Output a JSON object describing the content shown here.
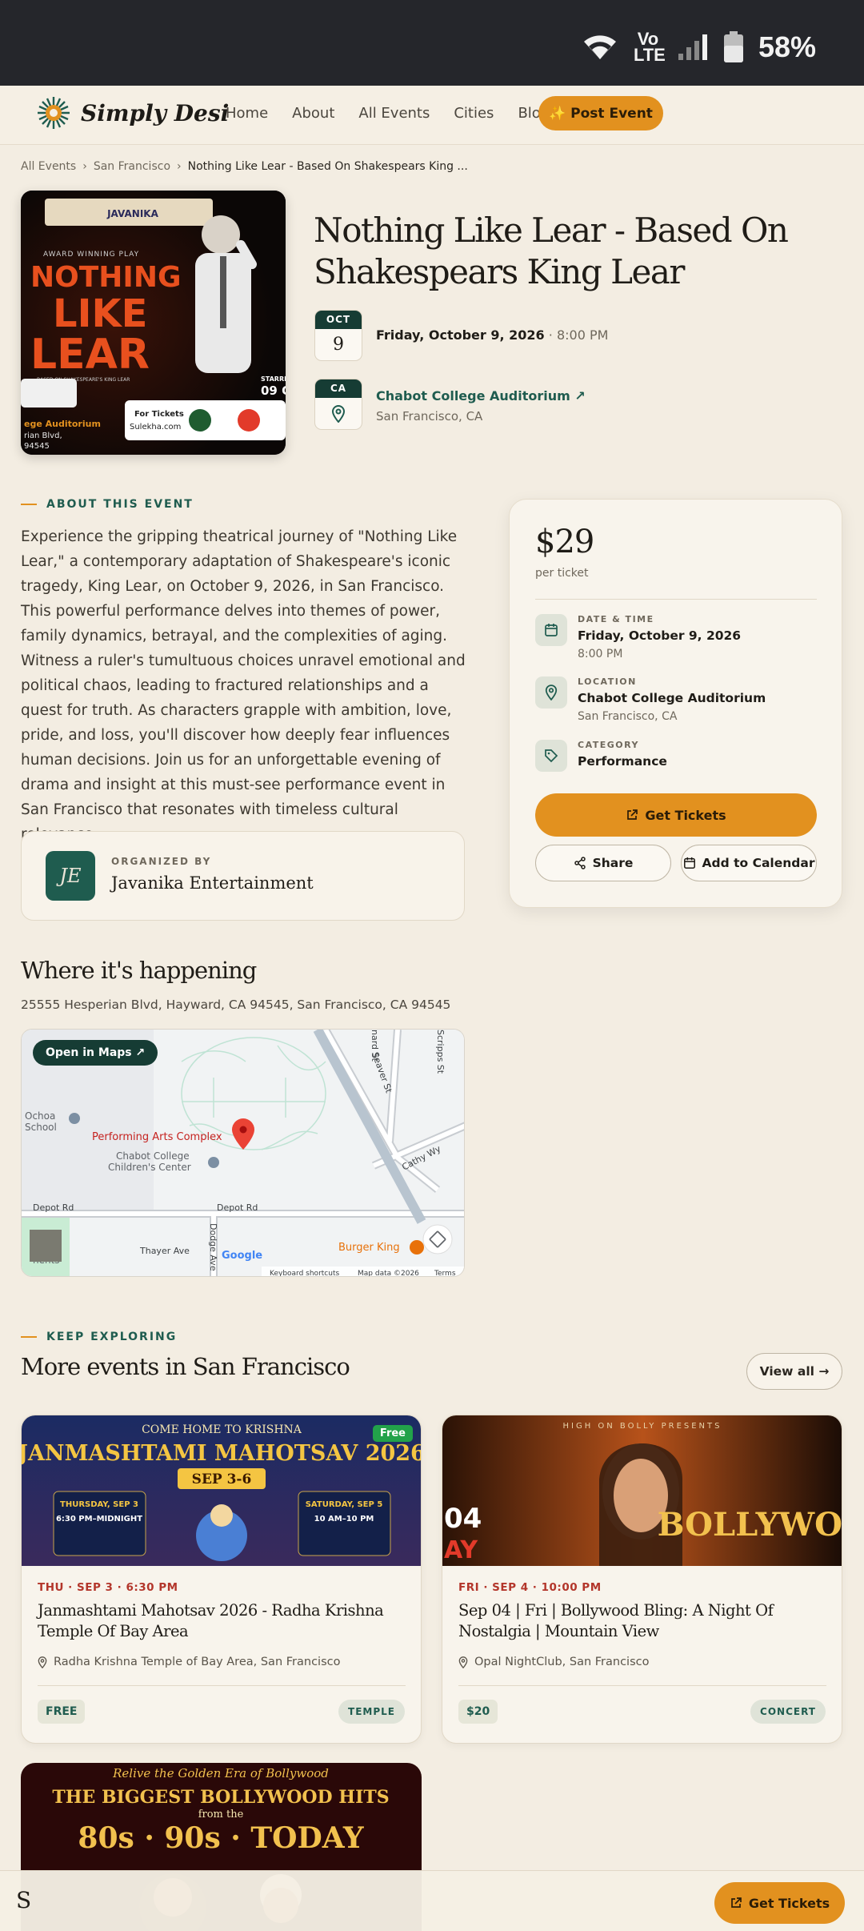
{
  "status_bar": {
    "network": "Vo LTE",
    "battery": "58%"
  },
  "header": {
    "logo_text": "Simply Desi",
    "nav": [
      "Home",
      "About",
      "All Events",
      "Cities",
      "Blogs"
    ],
    "post_event": "✨ Post Event"
  },
  "breadcrumb": [
    "All Events",
    "San Francisco",
    "Nothing Like Lear - Based On Shakespears King ..."
  ],
  "event": {
    "title": "Nothing Like Lear - Based On Shakespears King Lear",
    "month": "OCT",
    "day": "9",
    "date": "Friday, October 9, 2026",
    "time": "8:00 PM",
    "state": "CA",
    "venue": "Chabot College Auditorium ↗",
    "city": "San Francisco, CA"
  },
  "poster": {
    "top_logo": "JAVANIKA",
    "tagline": "AWARD WINNING PLAY",
    "line1": "NOTHING",
    "line2": "LIKE",
    "line3": "LEAR",
    "subtitle": "BASED ON SHAKESPEARE'S KING LEAR",
    "venue_fragment": "ege Auditorium",
    "addr_fragment": "rian Blvd,",
    "zip_fragment": "94545",
    "tickets_label": "For Tickets",
    "tickets_site": "Sulekha.com",
    "date_fragment": "09 O",
    "starring": "STARRI"
  },
  "about": {
    "eyebrow": "ABOUT THIS EVENT",
    "text": "Experience the gripping theatrical journey of \"Nothing Like Lear,\" a contemporary adaptation of Shakespeare's iconic tragedy, King Lear, on October 9, 2026, in San Francisco. This powerful performance delves into themes of power, family dynamics, betrayal, and the complexities of aging. Witness a ruler's tumultuous choices unravel emotional and political chaos, leading to fractured relationships and a quest for truth. As characters grapple with ambition, love, pride, and loss, you'll discover how deeply fear influences human decisions. Join us for an unforgettable evening of drama and insight at this must-see performance event in San Francisco that resonates with timeless cultural relevance."
  },
  "organizer": {
    "label": "ORGANIZED BY",
    "initials": "JE",
    "name": "Javanika Entertainment"
  },
  "ticket": {
    "price": "$29",
    "per": "per ticket",
    "date_label": "DATE & TIME",
    "date_value": "Friday, October 9, 2026",
    "time_value": "8:00 PM",
    "location_label": "LOCATION",
    "location_value": "Chabot College Auditorium",
    "location_sub": "San Francisco, CA",
    "category_label": "CATEGORY",
    "category_value": "Performance",
    "get_tickets": "Get Tickets",
    "share": "Share",
    "add_calendar": "Add to Calendar"
  },
  "where": {
    "title": "Where it's happening",
    "address": "25555 Hesperian Blvd, Hayward, CA 94545, San Francisco, CA 94545",
    "open_maps": "Open in Maps ↗",
    "map_labels": {
      "poi_main": "Performing Arts Complex",
      "school1": "Ochoa",
      "school1b": "School",
      "school2": "Chabot College",
      "school2b": "Children's Center",
      "road1": "Depot Rd",
      "road2": "Depot Rd",
      "road3": "Thayer Ave",
      "road4": "Dodge Ave",
      "road5": "Cathy Wy",
      "road6": "Seaver St",
      "road7": "nard St",
      "road8": "Scripps St",
      "poi_food": "Burger King",
      "apts": "nents",
      "google": "Google",
      "attrib1": "Keyboard shortcuts",
      "attrib2": "Map data ©2026",
      "attrib3": "Terms"
    }
  },
  "more": {
    "eyebrow": "KEEP EXPLORING",
    "title": "More events in San Francisco",
    "view_all": "View all →",
    "cards": [
      {
        "date": "THU · SEP 3 · 6:30 PM",
        "title": "Janmashtami Mahotsav 2026 - Radha Krishna Temple Of Bay Area",
        "location": "Radha Krishna Temple of Bay Area, San Francisco",
        "price": "FREE",
        "tag": "TEMPLE",
        "badge": "Free",
        "img_top": "COME HOME TO KRISHNA",
        "img_title": "JANMASHTAMI MAHOTSAV 2026",
        "img_dates": "SEP 3-6",
        "img_left_day": "THURSDAY, SEP 3",
        "img_left_time": "6:30 PM–MIDNIGHT",
        "img_right_day": "SATURDAY, SEP 5",
        "img_right_time": "10 AM–10 PM"
      },
      {
        "date": "FRI · SEP 4 · 10:00 PM",
        "title": "Sep 04 | Fri | Bollywood Bling: A Night Of Nostalgia | Mountain View",
        "location": "Opal NightClub, San Francisco",
        "price": "$20",
        "tag": "CONCERT",
        "img_top": "HIGH ON BOLLY PRESENTS",
        "img_date": "04",
        "img_day": "AY",
        "img_word": "BOLLYWO"
      }
    ],
    "card3": {
      "img_top": "Relive the Golden Era of Bollywood",
      "img_title": "THE BIGGEST BOLLYWOOD HITS",
      "img_from": "from the",
      "img_decades": "80s · 90s · TODAY"
    }
  },
  "bottom_bar": {
    "get_tickets": "Get Tickets",
    "left_char": "S"
  },
  "colors": {
    "accent": "#e2911f",
    "brand": "#163c34",
    "background": "#f3ede2"
  }
}
